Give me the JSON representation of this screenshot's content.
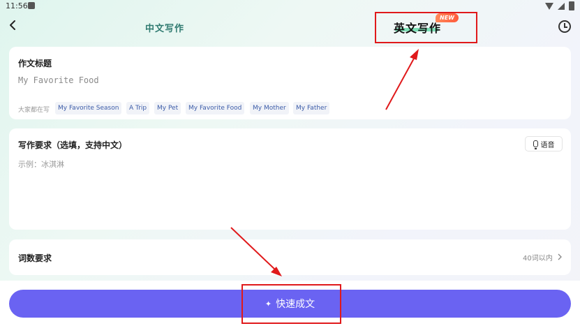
{
  "status_bar": {
    "time": "11:56"
  },
  "header": {
    "tab_chinese": "中文写作",
    "tab_english": "英文写作",
    "new_badge": "NEW"
  },
  "title_card": {
    "label": "作文标题",
    "input_placeholder": "My Favorite Food",
    "hot_label": "大家都在写",
    "chips": [
      "My Favorite Season",
      "A Trip",
      "My Pet",
      "My Favorite Food",
      "My Mother",
      "My Father"
    ]
  },
  "requirement_card": {
    "label": "写作要求（选填，支持中文）",
    "voice_label": "语音",
    "placeholder": "示例：冰淇淋"
  },
  "word_count_card": {
    "label": "词数要求",
    "value": "40词以内"
  },
  "submit": {
    "label": "快速成文"
  },
  "colors": {
    "accent": "#6a63f2",
    "annotation": "#e0191b",
    "chip_text": "#3b5ba8"
  }
}
